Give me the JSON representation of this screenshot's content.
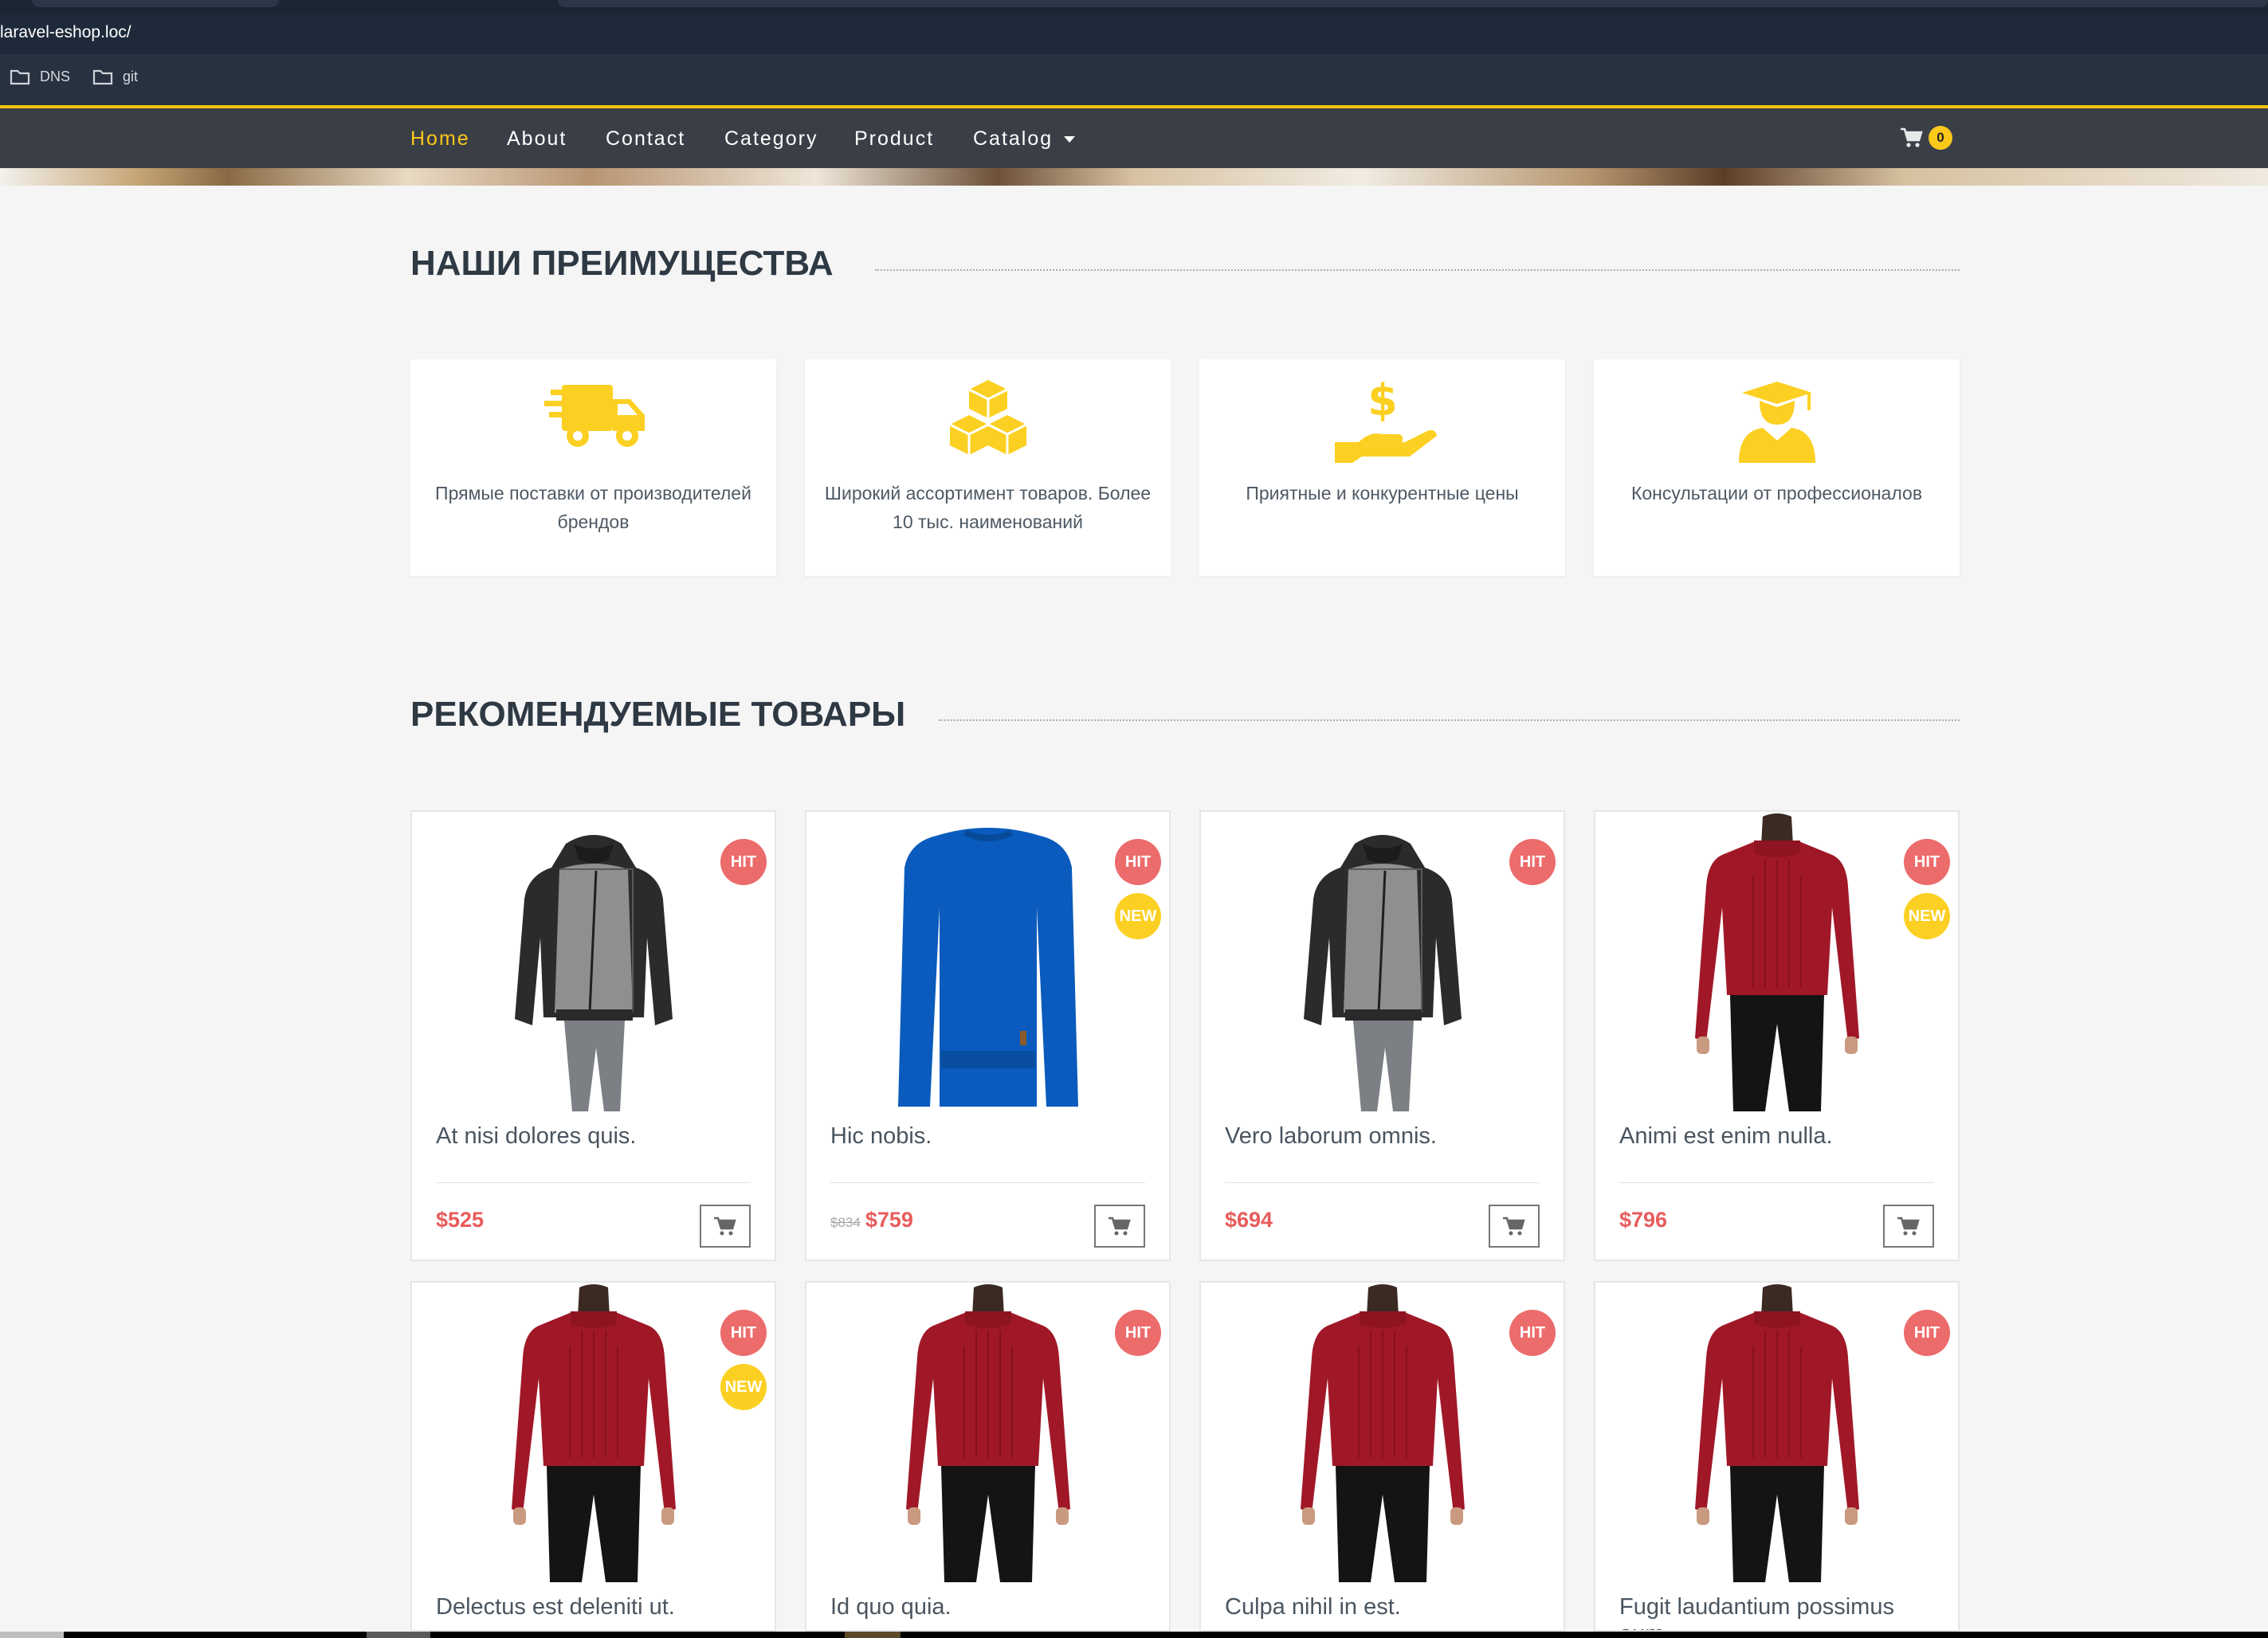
{
  "browser": {
    "url": "laravel-eshop.loc/",
    "bookmarks": [
      {
        "label": "DNS",
        "icon": "folder-icon"
      },
      {
        "label": "git",
        "icon": "folder-icon"
      }
    ]
  },
  "nav": {
    "items": [
      "Home",
      "About",
      "Contact",
      "Category",
      "Product",
      "Catalog"
    ],
    "active": "Home",
    "cart_count": "0"
  },
  "advantages": {
    "title": "НАШИ ПРЕИМУЩЕСТВА",
    "items": [
      {
        "icon": "truck-icon",
        "text": "Прямые поставки от производителей брендов"
      },
      {
        "icon": "boxes-icon",
        "text": "Широкий ассортимент товаров. Более 10 тыс. наименований"
      },
      {
        "icon": "hand-dollar-icon",
        "text": "Приятные и конкурентные цены"
      },
      {
        "icon": "graduate-icon",
        "text": "Консультации от профессионалов"
      }
    ]
  },
  "featured": {
    "title": "РЕКОМЕНДУЕМЫЕ ТОВАРЫ",
    "products": [
      {
        "name": "At nisi dolores quis.",
        "price": "$525",
        "old_price": "",
        "hit": "HIT",
        "new": "",
        "image": "jacket"
      },
      {
        "name": "Hic nobis.",
        "price": "$759",
        "old_price": "$834",
        "hit": "HIT",
        "new": "NEW",
        "image": "blue-sweater"
      },
      {
        "name": "Vero laborum omnis.",
        "price": "$694",
        "old_price": "",
        "hit": "HIT",
        "new": "",
        "image": "jacket"
      },
      {
        "name": "Animi est enim nulla.",
        "price": "$796",
        "old_price": "",
        "hit": "HIT",
        "new": "NEW",
        "image": "red-sweater"
      },
      {
        "name": "Delectus est deleniti ut.",
        "price": "",
        "old_price": "",
        "hit": "HIT",
        "new": "NEW",
        "image": "red-sweater"
      },
      {
        "name": "Id quo quia.",
        "price": "",
        "old_price": "",
        "hit": "HIT",
        "new": "",
        "image": "red-sweater"
      },
      {
        "name": "Culpa nihil in est.",
        "price": "",
        "old_price": "",
        "hit": "HIT",
        "new": "",
        "image": "red-sweater"
      },
      {
        "name": "Fugit laudantium possimus eum.",
        "price": "",
        "old_price": "",
        "hit": "HIT",
        "new": "",
        "image": "red-sweater"
      }
    ]
  },
  "colors": {
    "accent": "#fbc91a",
    "navbar": "#3a3f47",
    "hit_badge": "#ec6b6b",
    "new_badge": "#fcd022",
    "price": "#e85c5c"
  }
}
